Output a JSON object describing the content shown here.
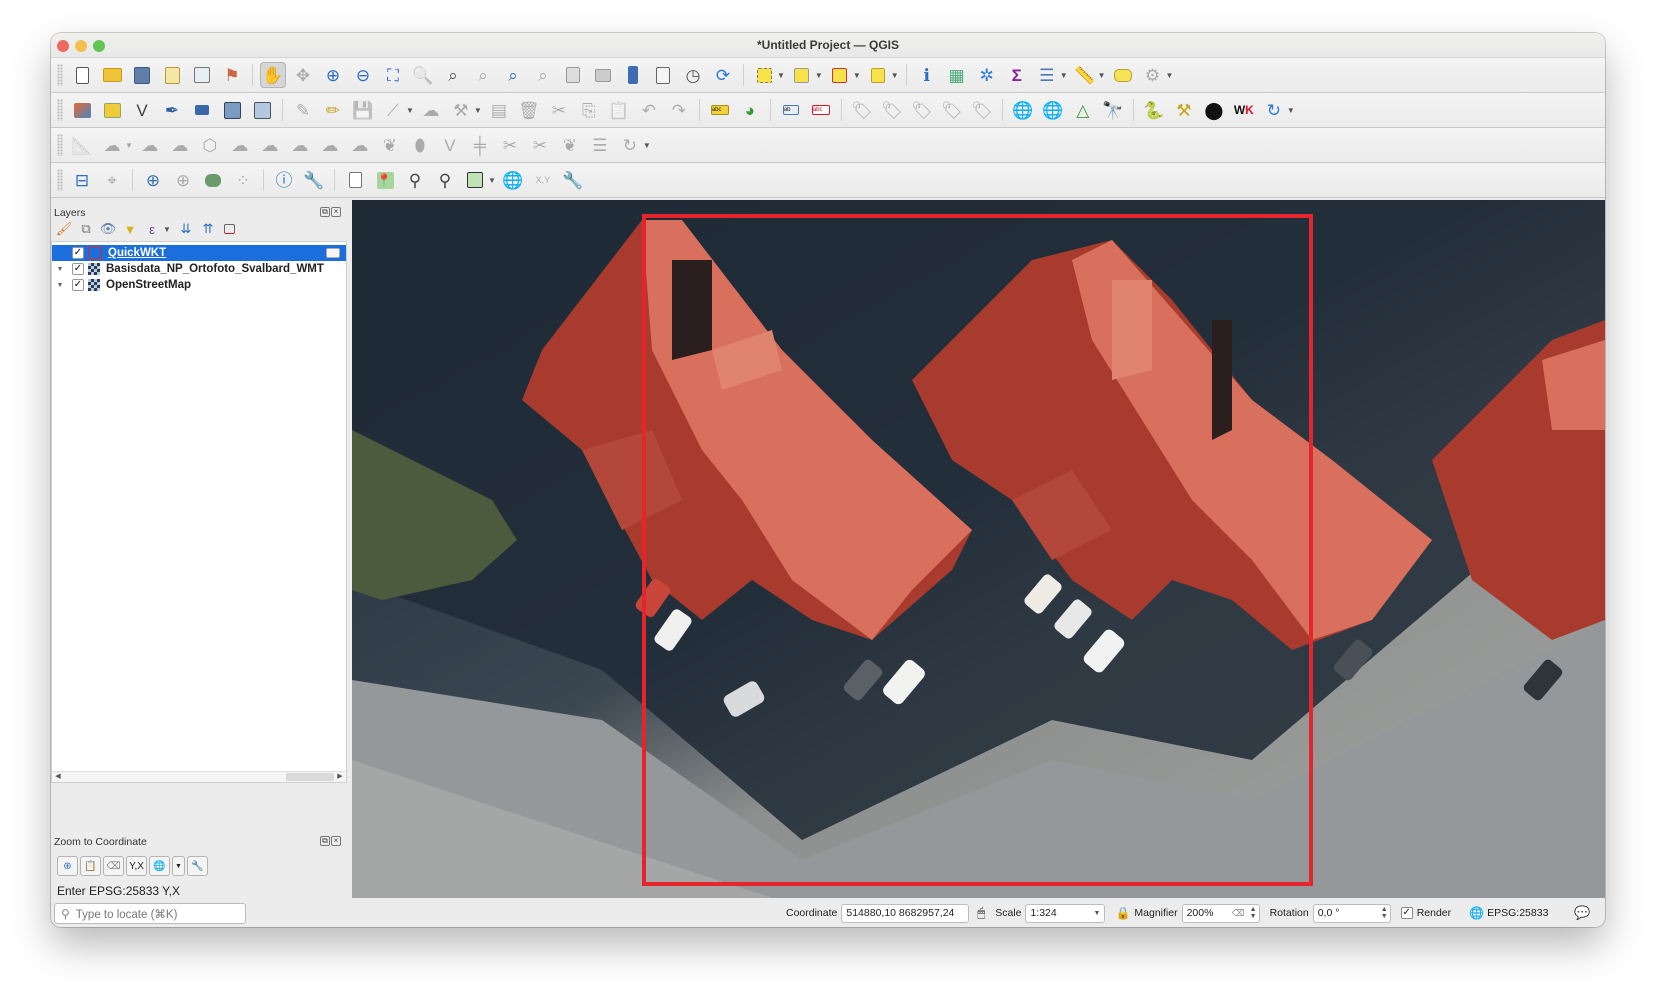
{
  "window": {
    "title": "*Untitled Project — QGIS"
  },
  "toolbars": {
    "row1": [
      "new-project",
      "open-project",
      "save-project",
      "new-print-layout",
      "show-layout-manager",
      "style-manager",
      "pan-map",
      "pan-to-selection",
      "zoom-in",
      "zoom-out",
      "zoom-full",
      "zoom-to-selection",
      "zoom-to-layer",
      "zoom-native",
      "zoom-last",
      "zoom-next",
      "new-map-view",
      "new-3d-map-view",
      "new-bookmark",
      "show-bookmarks",
      "temporal-controller",
      "refresh",
      "select-features",
      "select-by-attributes",
      "deselect",
      "select-by-location",
      "identify",
      "field-calculator",
      "processing-toolbox",
      "statistical-summary",
      "attribute-table",
      "measure",
      "map-tips",
      "locator-filter"
    ],
    "row2": [
      "data-source-manager",
      "new-geopackage-layer",
      "new-shapefile-layer",
      "new-spatialite-layer",
      "new-virtual-layer",
      "new-mesh-layer",
      "new-temporary-scratch-layer",
      "current-edits",
      "toggle-editing",
      "save-layer-edits",
      "digitize",
      "vertex-tool",
      "delete-selected",
      "cut",
      "copy",
      "paste",
      "undo",
      "redo",
      "label-toolbar",
      "diagram",
      "pin-labels",
      "show-hide-labels",
      "move-label",
      "rotate-label",
      "change-label",
      "wms-add",
      "wfs-add",
      "metasearch",
      "georeferencer",
      "python-console",
      "plugin-builder",
      "openlayers",
      "quickwkt",
      "plugin-reloader"
    ],
    "row3": [
      "advanced-digitizing",
      "add-ring",
      "add-part",
      "fill-ring",
      "delete-ring",
      "delete-part",
      "reshape",
      "offset-curve",
      "split-features",
      "split-parts",
      "merge-features",
      "merge-attributes",
      "rotate-point-symbols",
      "simplify",
      "reverse-line",
      "trim-extend"
    ],
    "row4": [
      "coordinate-capture",
      "crosshair",
      "zoom-to-coordinate",
      "snapping",
      "quickwkt-layer",
      "trace",
      "identify-info",
      "settings",
      "copy-coordinate",
      "pin",
      "zoom-to-point",
      "zoom-to-points",
      "zoom-to-extent",
      "crs-selector",
      "xy-tools",
      "configure"
    ]
  },
  "layers_panel": {
    "title": "Layers",
    "items": [
      {
        "name": "QuickWKT",
        "checked": true,
        "selected": true,
        "type": "vector"
      },
      {
        "name": "Basisdata_NP_Ortofoto_Svalbard_WMT",
        "checked": true,
        "selected": false,
        "type": "raster"
      },
      {
        "name": "OpenStreetMap",
        "checked": true,
        "selected": false,
        "type": "raster"
      }
    ]
  },
  "zoom_to_coordinate": {
    "title": "Zoom to Coordinate",
    "yx_label": "Y,X",
    "prompt": "Enter EPSG:25833 Y,X",
    "input_value": ""
  },
  "statusbar": {
    "locate_placeholder": "Type to locate (⌘K)",
    "coordinate_label": "Coordinate",
    "coordinate_value": "514880,10  8682957,24",
    "scale_label": "Scale",
    "scale_value": "1:324",
    "magnifier_label": "Magnifier",
    "magnifier_value": "200%",
    "rotation_label": "Rotation",
    "rotation_value": "0,0 °",
    "render_label": "Render",
    "render_checked": true,
    "crs": "EPSG:25833"
  },
  "map": {
    "highlight_color": "#e4262c",
    "roof_color": "#d8705d"
  }
}
